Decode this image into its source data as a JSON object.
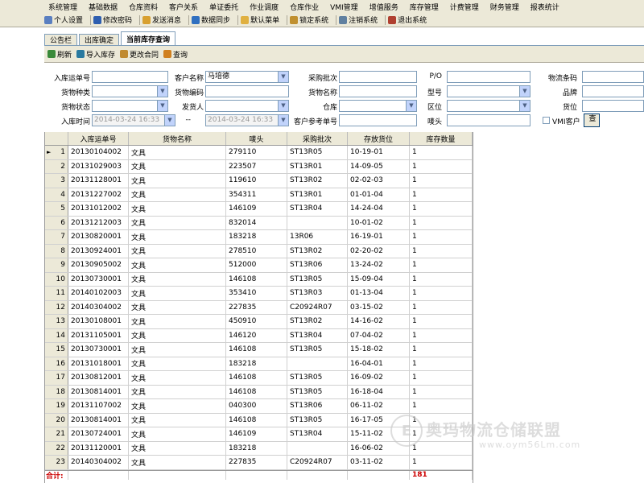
{
  "menu": [
    "系统管理",
    "基础数据",
    "仓库资料",
    "客户关系",
    "单证委托",
    "作业调度",
    "仓库作业",
    "VMI管理",
    "增值服务",
    "库存管理",
    "计费管理",
    "财务管理",
    "报表统计"
  ],
  "toolbar": [
    {
      "label": "个人设置",
      "icon": "person-icon",
      "color": "#5a7fc0"
    },
    {
      "label": "修改密码",
      "icon": "key-icon",
      "color": "#2f5fb0"
    },
    {
      "label": "发送消息",
      "icon": "mail-icon",
      "color": "#d8a030"
    },
    {
      "label": "数据同步",
      "icon": "sync-icon",
      "color": "#3070c0"
    },
    {
      "label": "默认菜单",
      "icon": "menu-icon",
      "color": "#e0b040"
    },
    {
      "label": "锁定系统",
      "icon": "lock-icon",
      "color": "#c09030"
    },
    {
      "label": "注销系统",
      "icon": "logout-icon",
      "color": "#6080a0"
    },
    {
      "label": "退出系统",
      "icon": "exit-icon",
      "color": "#b04030"
    }
  ],
  "tabs": [
    {
      "label": "公告栏",
      "active": false
    },
    {
      "label": "出库确定",
      "active": false
    },
    {
      "label": "当前库存查询",
      "active": true
    }
  ],
  "subtoolbar": [
    {
      "label": "刷新",
      "icon": "refresh-icon",
      "color": "#3a8a3a"
    },
    {
      "label": "导入库存",
      "icon": "import-icon",
      "color": "#2a7aa0"
    },
    {
      "label": "更改合同",
      "icon": "contract-icon",
      "color": "#c08a30"
    },
    {
      "label": "查询",
      "icon": "search-icon",
      "color": "#d08020"
    }
  ],
  "form": {
    "inbound_no": {
      "label": "入库运单号",
      "value": ""
    },
    "customer_name": {
      "label": "客户名称",
      "value": "马培德"
    },
    "purchase_batch": {
      "label": "采购批次",
      "value": ""
    },
    "po": {
      "label": "P/O",
      "value": ""
    },
    "logistics_barcode": {
      "label": "物流条码",
      "value": ""
    },
    "goods_type": {
      "label": "货物种类",
      "value": ""
    },
    "goods_code": {
      "label": "货物编码",
      "value": ""
    },
    "goods_name": {
      "label": "货物名称",
      "value": ""
    },
    "model": {
      "label": "型号",
      "value": ""
    },
    "brand": {
      "label": "品牌",
      "value": ""
    },
    "goods_status": {
      "label": "货物状态",
      "value": ""
    },
    "consignor": {
      "label": "发货人",
      "value": ""
    },
    "warehouse": {
      "label": "仓库",
      "value": ""
    },
    "zone": {
      "label": "区位",
      "value": ""
    },
    "location": {
      "label": "货位",
      "value": ""
    },
    "inbound_time": {
      "label": "入库时间",
      "from": "2014-03-24 16:33",
      "sep": "--",
      "to": "2014-03-24 16:33"
    },
    "customer_ref_no": {
      "label": "客户参考单号",
      "value": ""
    },
    "mark": {
      "label": "唛头",
      "value": ""
    },
    "vmi_customer": {
      "label": "VMI客户",
      "checked": false
    },
    "query_btn": "查"
  },
  "grid": {
    "columns": [
      "入库运单号",
      "货物名称",
      "唛头",
      "采购批次",
      "存放货位",
      "库存数量"
    ],
    "rows": [
      [
        "1",
        "20130104002",
        "文具",
        "279110",
        "ST13R05",
        "10-19-01",
        "1"
      ],
      [
        "2",
        "20131029003",
        "文具",
        "223507",
        "ST13R01",
        "14-09-05",
        "1"
      ],
      [
        "3",
        "20131128001",
        "文具",
        "119610",
        "ST13R02",
        "02-02-03",
        "1"
      ],
      [
        "4",
        "20131227002",
        "文具",
        "354311",
        "ST13R01",
        "01-01-04",
        "1"
      ],
      [
        "5",
        "20131012002",
        "文具",
        "146109",
        "ST13R04",
        "14-24-04",
        "1"
      ],
      [
        "6",
        "20131212003",
        "文具",
        "832014",
        "",
        "10-01-02",
        "1"
      ],
      [
        "7",
        "20130820001",
        "文具",
        "183218",
        "13R06",
        "16-19-01",
        "1"
      ],
      [
        "8",
        "20130924001",
        "文具",
        "278510",
        "ST13R02",
        "02-20-02",
        "1"
      ],
      [
        "9",
        "20130905002",
        "文具",
        "512000",
        "ST13R06",
        "13-24-02",
        "1"
      ],
      [
        "10",
        "20130730001",
        "文具",
        "146108",
        "ST13R05",
        "15-09-04",
        "1"
      ],
      [
        "11",
        "20140102003",
        "文具",
        "353410",
        "ST13R03",
        "01-13-04",
        "1"
      ],
      [
        "12",
        "20140304002",
        "文具",
        "227835",
        "C20924R07",
        "03-15-02",
        "1"
      ],
      [
        "13",
        "20130108001",
        "文具",
        "450910",
        "ST13R02",
        "14-16-02",
        "1"
      ],
      [
        "14",
        "20131105001",
        "文具",
        "146120",
        "ST13R04",
        "07-04-02",
        "1"
      ],
      [
        "15",
        "20130730001",
        "文具",
        "146108",
        "ST13R05",
        "15-18-02",
        "1"
      ],
      [
        "16",
        "20131018001",
        "文具",
        "183218",
        "",
        "16-04-01",
        "1"
      ],
      [
        "17",
        "20130812001",
        "文具",
        "146108",
        "ST13R05",
        "16-09-02",
        "1"
      ],
      [
        "18",
        "20130814001",
        "文具",
        "146108",
        "ST13R05",
        "16-18-04",
        "1"
      ],
      [
        "19",
        "20131107002",
        "文具",
        "040300",
        "ST13R06",
        "06-11-02",
        "1"
      ],
      [
        "20",
        "20130814001",
        "文具",
        "146108",
        "ST13R05",
        "16-17-05",
        "1"
      ],
      [
        "21",
        "20130724001",
        "文具",
        "146109",
        "ST13R04",
        "15-11-02",
        "1"
      ],
      [
        "22",
        "20131120001",
        "文具",
        "183218",
        "",
        "16-06-02",
        "1"
      ],
      [
        "23",
        "20140304002",
        "文具",
        "227835",
        "C20924R07",
        "03-11-02",
        "1"
      ]
    ],
    "total_label": "合计:",
    "total_value": "181"
  },
  "watermark": {
    "logo": "E",
    "text": "奥玛物流仓储联盟",
    "url": "www.oym56Lm.com"
  }
}
